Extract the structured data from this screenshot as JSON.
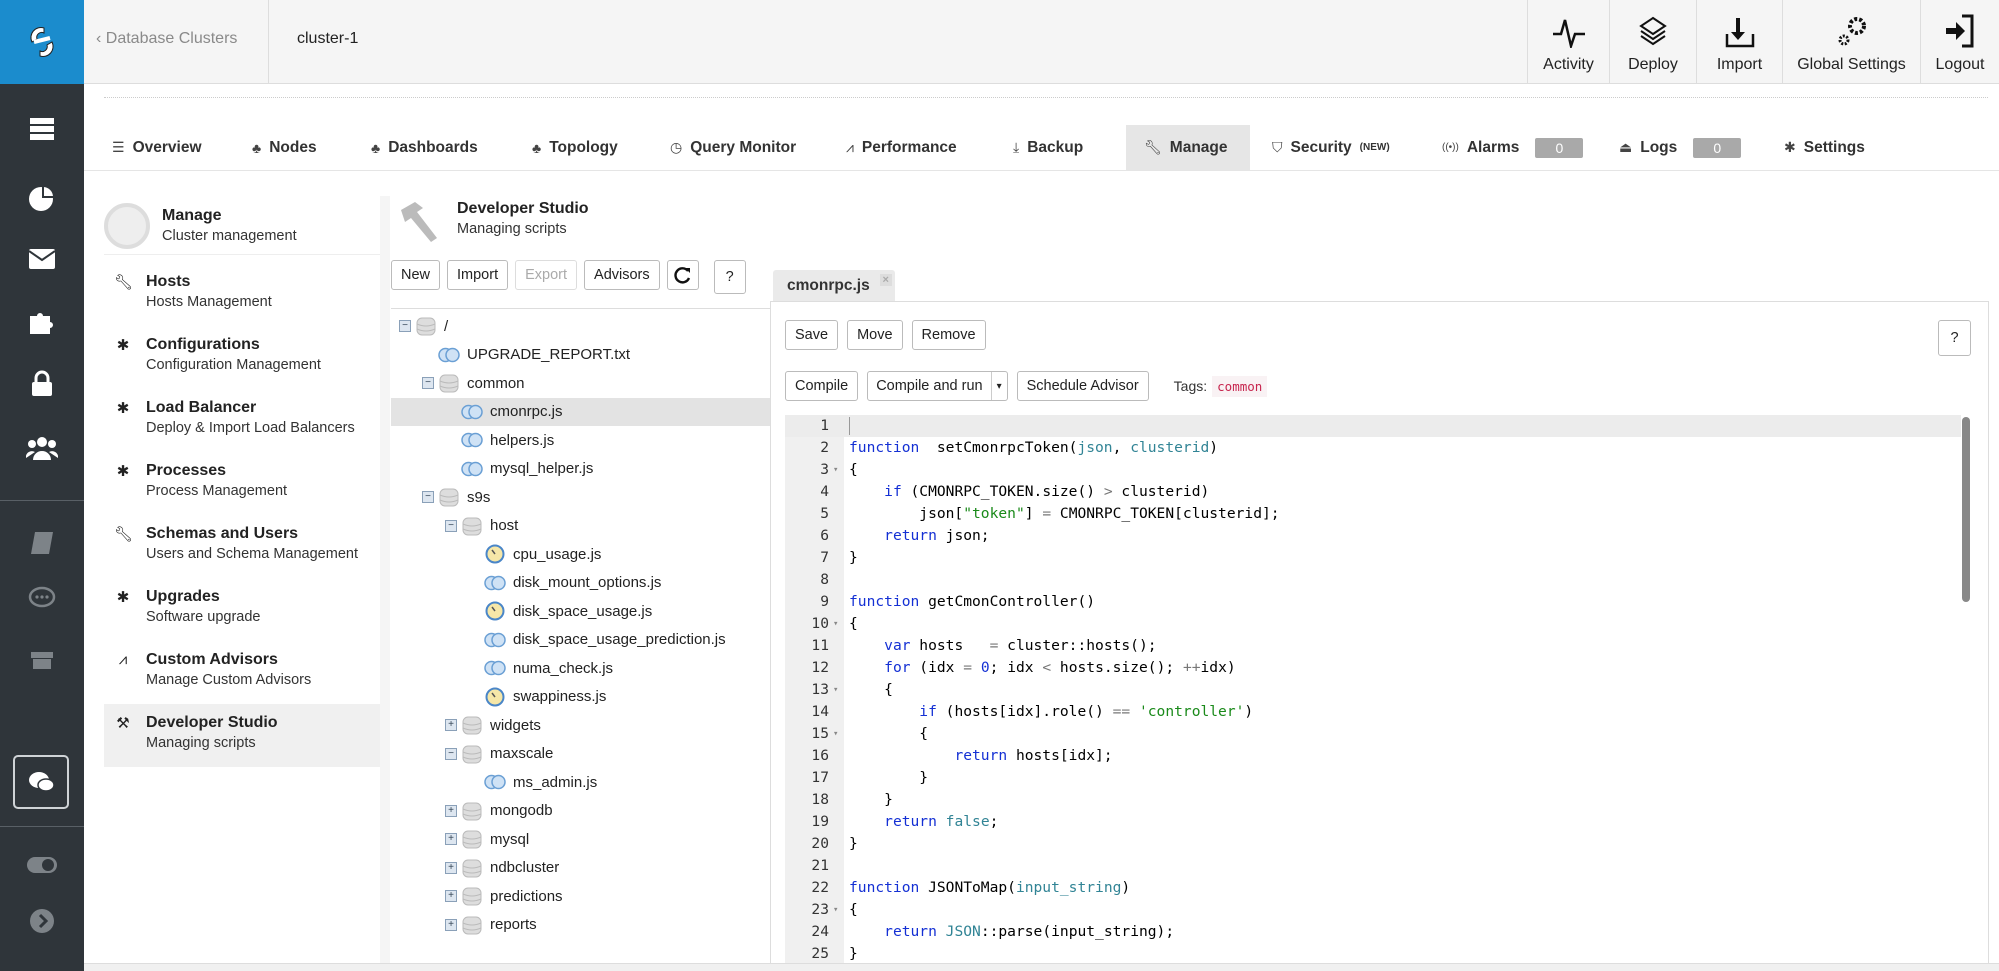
{
  "colors": {
    "brand": "#1b8ccd",
    "rail": "#2f353a",
    "tag": "#c7254e"
  },
  "rail": {
    "icons": [
      "server-icon",
      "pie-chart-icon",
      "envelope-icon",
      "puzzle-icon",
      "lock-icon",
      "users-icon",
      "book-icon",
      "comment-icon",
      "gift-icon",
      "chat-icon",
      "toggle-icon",
      "chevron-right-icon"
    ]
  },
  "header": {
    "back_label": "Database Clusters",
    "cluster": "cluster-1",
    "buttons": [
      {
        "label": "Activity",
        "icon": "pulse-icon"
      },
      {
        "label": "Deploy",
        "icon": "layers-icon"
      },
      {
        "label": "Import",
        "icon": "import-icon"
      },
      {
        "label": "Global Settings",
        "icon": "gears-icon"
      },
      {
        "label": "Logout",
        "icon": "logout-icon"
      }
    ]
  },
  "tabs": [
    {
      "label": "Overview",
      "icon": "list-icon"
    },
    {
      "label": "Nodes",
      "icon": "sitemap-icon"
    },
    {
      "label": "Dashboards",
      "icon": "sitemap-icon"
    },
    {
      "label": "Topology",
      "icon": "sitemap-icon"
    },
    {
      "label": "Query Monitor",
      "icon": "gauge-icon"
    },
    {
      "label": "Performance",
      "icon": "chart-icon"
    },
    {
      "label": "Backup",
      "icon": "download-icon"
    },
    {
      "label": "Manage",
      "icon": "wrench-icon",
      "active": true
    },
    {
      "label": "Security",
      "sup": "(NEW)",
      "icon": "shield-icon"
    },
    {
      "label": "Alarms",
      "icon": "signal-icon",
      "badge": "0"
    },
    {
      "label": "Logs",
      "icon": "inbox-icon",
      "badge": "0"
    },
    {
      "label": "Settings",
      "icon": "gear-icon"
    }
  ],
  "subnav": {
    "title": "Manage",
    "subtitle": "Cluster management",
    "items": [
      {
        "title": "Hosts",
        "subtitle": "Hosts Management",
        "icon": "wrench-icon"
      },
      {
        "title": "Configurations",
        "subtitle": "Configuration Management",
        "icon": "gear-icon"
      },
      {
        "title": "Load Balancer",
        "subtitle": "Deploy & Import Load Balancers",
        "icon": "gear-icon"
      },
      {
        "title": "Processes",
        "subtitle": "Process Management",
        "icon": "gear-icon"
      },
      {
        "title": "Schemas and Users",
        "subtitle": "Users and Schema Management",
        "icon": "wrench-icon"
      },
      {
        "title": "Upgrades",
        "subtitle": "Software upgrade",
        "icon": "gear-icon"
      },
      {
        "title": "Custom Advisors",
        "subtitle": "Manage Custom Advisors",
        "icon": "chart-icon"
      },
      {
        "title": "Developer Studio",
        "subtitle": "Managing scripts",
        "icon": "hammer-icon",
        "selected": true
      }
    ]
  },
  "studio": {
    "title": "Developer Studio",
    "subtitle": "Managing scripts",
    "buttons": {
      "new": "New",
      "import": "Import",
      "export": "Export",
      "advisors": "Advisors",
      "help": "?"
    },
    "tree": [
      {
        "name": "/",
        "depth": 0,
        "type": "folder",
        "state": "open"
      },
      {
        "name": "UPGRADE_REPORT.txt",
        "depth": 1,
        "type": "file"
      },
      {
        "name": "common",
        "depth": 1,
        "type": "folder",
        "state": "open"
      },
      {
        "name": "cmonrpc.js",
        "depth": 2,
        "type": "file",
        "selected": true
      },
      {
        "name": "helpers.js",
        "depth": 2,
        "type": "file"
      },
      {
        "name": "mysql_helper.js",
        "depth": 2,
        "type": "file"
      },
      {
        "name": "s9s",
        "depth": 1,
        "type": "folder",
        "state": "open"
      },
      {
        "name": "host",
        "depth": 2,
        "type": "folder",
        "state": "open"
      },
      {
        "name": "cpu_usage.js",
        "depth": 3,
        "type": "advisor"
      },
      {
        "name": "disk_mount_options.js",
        "depth": 3,
        "type": "file"
      },
      {
        "name": "disk_space_usage.js",
        "depth": 3,
        "type": "advisor"
      },
      {
        "name": "disk_space_usage_prediction.js",
        "depth": 3,
        "type": "file"
      },
      {
        "name": "numa_check.js",
        "depth": 3,
        "type": "file"
      },
      {
        "name": "swappiness.js",
        "depth": 3,
        "type": "advisor"
      },
      {
        "name": "widgets",
        "depth": 2,
        "type": "folder",
        "state": "closed"
      },
      {
        "name": "maxscale",
        "depth": 2,
        "type": "folder",
        "state": "open"
      },
      {
        "name": "ms_admin.js",
        "depth": 3,
        "type": "file"
      },
      {
        "name": "mongodb",
        "depth": 2,
        "type": "folder",
        "state": "closed"
      },
      {
        "name": "mysql",
        "depth": 2,
        "type": "folder",
        "state": "closed"
      },
      {
        "name": "ndbcluster",
        "depth": 2,
        "type": "folder",
        "state": "closed"
      },
      {
        "name": "predictions",
        "depth": 2,
        "type": "folder",
        "state": "closed"
      },
      {
        "name": "reports",
        "depth": 2,
        "type": "folder",
        "state": "closed"
      }
    ]
  },
  "editor": {
    "tab": "cmonrpc.js",
    "close": "×",
    "buttons": {
      "save": "Save",
      "move": "Move",
      "remove": "Remove",
      "help": "?",
      "compile": "Compile",
      "compile_run": "Compile and run",
      "caret": "▾",
      "schedule": "Schedule Advisor"
    },
    "tags_label": "Tags:",
    "tag": "common",
    "lines": [
      [],
      [
        [
          "kw",
          "function"
        ],
        [
          "",
          "  setCmonrpcToken("
        ],
        [
          "pa",
          "json"
        ],
        [
          "",
          ", "
        ],
        [
          "pa",
          "clusterid"
        ],
        [
          "",
          ")"
        ]
      ],
      [
        [
          "",
          "{"
        ]
      ],
      [
        [
          "",
          "    "
        ],
        [
          "kw",
          "if"
        ],
        [
          "",
          " (CMONRPC_TOKEN.size() "
        ],
        [
          "op",
          ">"
        ],
        [
          "",
          " clusterid)"
        ]
      ],
      [
        [
          "",
          "        json["
        ],
        [
          "st",
          "\"token\""
        ],
        [
          "",
          "] "
        ],
        [
          "op",
          "="
        ],
        [
          "",
          " CMONRPC_TOKEN[clusterid];"
        ]
      ],
      [
        [
          "",
          "    "
        ],
        [
          "kw",
          "return"
        ],
        [
          "",
          " json;"
        ]
      ],
      [
        [
          "",
          "}"
        ]
      ],
      [],
      [
        [
          "kw",
          "function"
        ],
        [
          "",
          " getCmonController()"
        ]
      ],
      [
        [
          "",
          "{"
        ]
      ],
      [
        [
          "",
          "    "
        ],
        [
          "kw",
          "var"
        ],
        [
          "",
          " hosts   "
        ],
        [
          "op",
          "="
        ],
        [
          "",
          " cluster::hosts();"
        ]
      ],
      [
        [
          "",
          "    "
        ],
        [
          "kw",
          "for"
        ],
        [
          "",
          " (idx "
        ],
        [
          "op",
          "="
        ],
        [
          "",
          " "
        ],
        [
          "nu",
          "0"
        ],
        [
          "",
          "; idx "
        ],
        [
          "op",
          "<"
        ],
        [
          "",
          " hosts.size(); "
        ],
        [
          "op",
          "++"
        ],
        [
          "",
          "idx)"
        ]
      ],
      [
        [
          "",
          "    {"
        ]
      ],
      [
        [
          "",
          "        "
        ],
        [
          "kw",
          "if"
        ],
        [
          "",
          " (hosts[idx].role() "
        ],
        [
          "op",
          "=="
        ],
        [
          "",
          " "
        ],
        [
          "st",
          "'controller'"
        ],
        [
          "",
          ")"
        ]
      ],
      [
        [
          "",
          "        {"
        ]
      ],
      [
        [
          "",
          "            "
        ],
        [
          "kw",
          "return"
        ],
        [
          "",
          " hosts[idx];"
        ]
      ],
      [
        [
          "",
          "        }"
        ]
      ],
      [
        [
          "",
          "    }"
        ]
      ],
      [
        [
          "",
          "    "
        ],
        [
          "kw",
          "return"
        ],
        [
          "",
          " "
        ],
        [
          "pa",
          "false"
        ],
        [
          "",
          ";"
        ]
      ],
      [
        [
          "",
          "}"
        ]
      ],
      [],
      [
        [
          "kw",
          "function"
        ],
        [
          "",
          " JSONToMap("
        ],
        [
          "pa",
          "input_string"
        ],
        [
          "",
          ")"
        ]
      ],
      [
        [
          "",
          "{"
        ]
      ],
      [
        [
          "",
          "    "
        ],
        [
          "kw",
          "return"
        ],
        [
          "",
          " "
        ],
        [
          "pa",
          "JSON"
        ],
        [
          "",
          "::parse(input_string);"
        ]
      ],
      [
        [
          "",
          "}"
        ]
      ]
    ],
    "folds": [
      3,
      10,
      13,
      15,
      23
    ]
  }
}
